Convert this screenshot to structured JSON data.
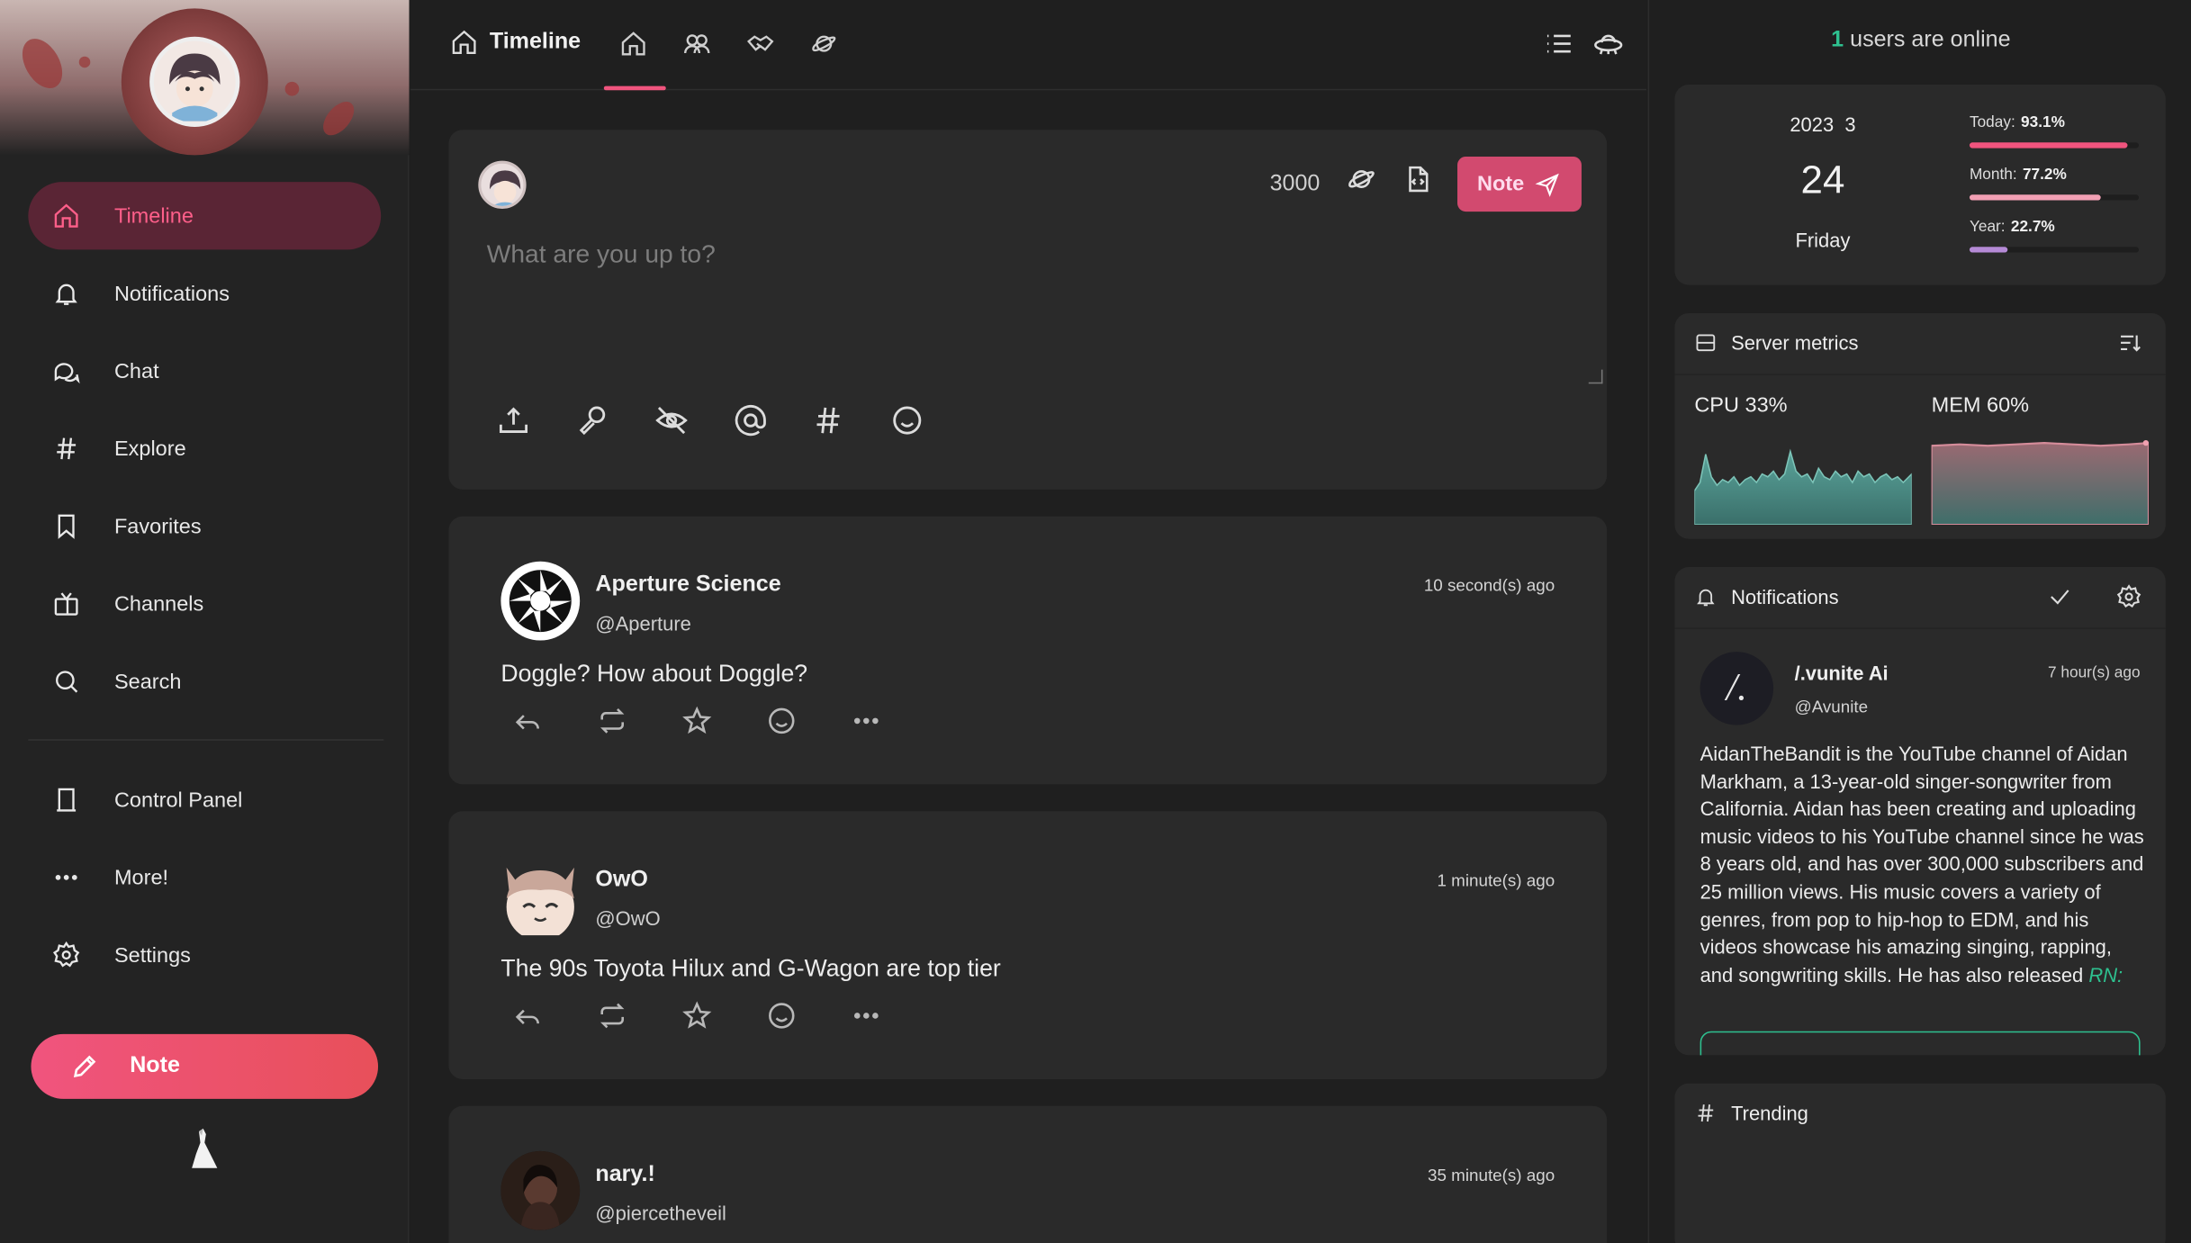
{
  "sidebar": {
    "items": [
      {
        "label": "Timeline",
        "icon": "home-icon"
      },
      {
        "label": "Notifications",
        "icon": "bell-icon"
      },
      {
        "label": "Chat",
        "icon": "chat-icon"
      },
      {
        "label": "Explore",
        "icon": "hash-icon"
      },
      {
        "label": "Favorites",
        "icon": "bookmark-icon"
      },
      {
        "label": "Channels",
        "icon": "tv-icon"
      },
      {
        "label": "Search",
        "icon": "search-icon"
      },
      {
        "label": "Control Panel",
        "icon": "door-icon"
      },
      {
        "label": "More!",
        "icon": "dots-icon"
      },
      {
        "label": "Settings",
        "icon": "gear-icon"
      }
    ],
    "note_button": "Note"
  },
  "topbar": {
    "title": "Timeline",
    "tabs": [
      "home-icon",
      "users-icon",
      "handshake-icon",
      "planet-icon"
    ],
    "right_icons": [
      "list-icon",
      "ufo-icon"
    ]
  },
  "composer": {
    "char_count": "3000",
    "placeholder": "What are you up to?",
    "note_button": "Note",
    "tools": [
      "upload-icon",
      "poll-icon",
      "eye-off-icon",
      "mention-icon",
      "hashtag-icon",
      "emoji-icon"
    ]
  },
  "posts": [
    {
      "name": "Aperture Science",
      "handle": "@Aperture",
      "time": "10 second(s) ago",
      "text": "Doggle? How about Doggle?"
    },
    {
      "name": "OwO",
      "handle": "@OwO",
      "time": "1 minute(s) ago",
      "text": "The 90s Toyota Hilux and G-Wagon are top tier"
    },
    {
      "name": "nary.!",
      "handle": "@piercetheveil",
      "time": "35 minute(s) ago",
      "text": ""
    }
  ],
  "right": {
    "online_count": "1",
    "online_text": "users are online",
    "date": {
      "year_month": "2023  3",
      "day": "24",
      "weekday": "Friday",
      "today_label": "Today:",
      "today_value": "93.1%",
      "today_fraction": 0.931,
      "month_label": "Month:",
      "month_value": "77.2%",
      "month_fraction": 0.772,
      "year_label": "Year:",
      "year_value": "22.7%",
      "year_fraction": 0.227
    },
    "metrics": {
      "title": "Server metrics",
      "cpu_label": "CPU 33%",
      "mem_label": "MEM 60%"
    },
    "notifications": {
      "title": "Notifications",
      "item": {
        "avatar_text": "/.",
        "name": "/.vunite Ai",
        "handle": "@Avunite",
        "time": "7 hour(s) ago",
        "body": "AidanTheBandit is the YouTube channel of Aidan Markham, a 13-year-old singer-songwriter from California. Aidan has been creating and uploading music videos to his YouTube channel since he was 8 years old, and has over 300,000 subscribers and 25 million views. His music covers a variety of genres, from pop to hip-hop to EDM, and his videos showcase his amazing singing, rapping, and songwriting skills. He has also released",
        "body_tail": "RN:"
      }
    },
    "trending": {
      "title": "Trending"
    }
  },
  "colors": {
    "accent": "#f0547e",
    "online_green": "#2ec08f",
    "today_bar": "#f0547e",
    "month_bar": "#f2a0b4",
    "year_bar": "#b58ad6"
  }
}
